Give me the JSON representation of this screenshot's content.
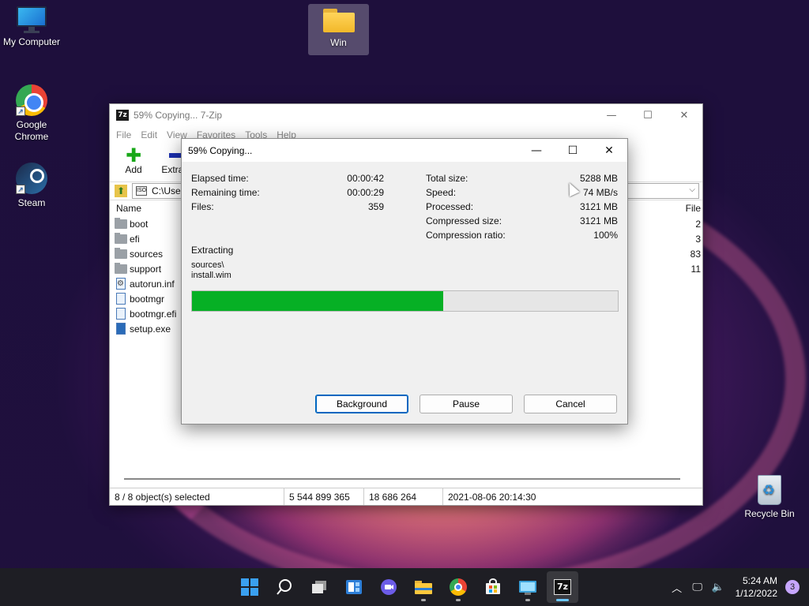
{
  "desktop": {
    "icons": [
      {
        "label": "My Computer"
      },
      {
        "label": "Google Chrome"
      },
      {
        "label": "Steam"
      },
      {
        "label": "Win"
      },
      {
        "label": "Recycle Bin"
      }
    ]
  },
  "main_window": {
    "title": "59% Copying... 7-Zip",
    "app_badge": "7z",
    "menu": [
      "File",
      "Edit",
      "View",
      "Favorites",
      "Tools",
      "Help"
    ],
    "toolbar": {
      "add_label": "Add",
      "extract_label": "Extract"
    },
    "address": "C:\\Use",
    "columns": {
      "name": "Name",
      "files": "File"
    },
    "files": [
      {
        "name": "boot",
        "type": "folder",
        "count": "2"
      },
      {
        "name": "efi",
        "type": "folder",
        "count": "3"
      },
      {
        "name": "sources",
        "type": "folder",
        "count": "83"
      },
      {
        "name": "support",
        "type": "folder",
        "count": "11"
      },
      {
        "name": "autorun.inf",
        "type": "config",
        "count": ""
      },
      {
        "name": "bootmgr",
        "type": "file",
        "count": ""
      },
      {
        "name": "bootmgr.efi",
        "type": "file",
        "count": ""
      },
      {
        "name": "setup.exe",
        "type": "exe",
        "count": ""
      }
    ],
    "status": {
      "selected": "8 / 8 object(s) selected",
      "size": "5 544 899 365",
      "packed": "18 686 264",
      "modified": "2021-08-06 20:14:30"
    }
  },
  "dialog": {
    "title": "59% Copying...",
    "left_stats": [
      {
        "label": "Elapsed time:",
        "value": "00:00:42"
      },
      {
        "label": "Remaining time:",
        "value": "00:00:29"
      },
      {
        "label": "Files:",
        "value": "359"
      }
    ],
    "right_stats": [
      {
        "label": "Total size:",
        "value": "5288 MB"
      },
      {
        "label": "Speed:",
        "value": "74 MB/s"
      },
      {
        "label": "Processed:",
        "value": "3121 MB"
      },
      {
        "label": "Compressed size:",
        "value": "3121 MB"
      },
      {
        "label": "Compression ratio:",
        "value": "100%"
      }
    ],
    "operation": "Extracting",
    "path_line1": "sources\\",
    "path_line2": "install.wim",
    "progress_fraction": 0.59,
    "buttons": {
      "background": "Background",
      "pause": "Pause",
      "cancel": "Cancel"
    }
  },
  "taskbar": {
    "clock_time": "5:24 AM",
    "clock_date": "1/12/2022",
    "notification_count": "3",
    "colors": {
      "accent": "#06b025",
      "taskbar": "#1e1e24"
    }
  }
}
